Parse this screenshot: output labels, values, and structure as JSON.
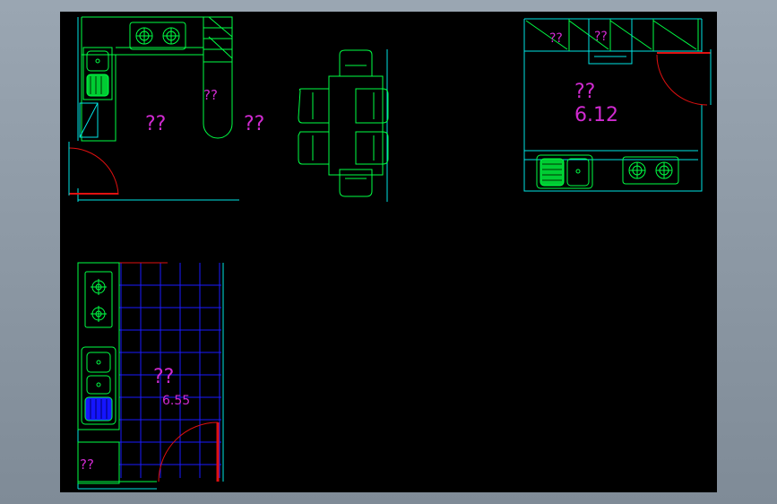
{
  "canvas": {
    "background": "#000000",
    "frame": "#8e9aa6"
  },
  "colors": {
    "wall": "#00e5e5",
    "fixture": "#00ff44",
    "door": "#e01010",
    "grid": "#1a1aff",
    "label": "#d02ad0",
    "sink_fill_green": "#00cc33",
    "sink_fill_blue": "#1515ff"
  },
  "labels": {
    "kitchen_a_left": "??",
    "kitchen_a_island": "??",
    "kitchen_a_right": "??",
    "kitchen_b_top1": "??",
    "kitchen_b_top2": "??",
    "kitchen_b_name": "??",
    "kitchen_b_area": "6.12",
    "kitchen_c_name": "??",
    "kitchen_c_area": "6.55",
    "kitchen_c_fridge": "??"
  },
  "icons": [
    "stove-icon",
    "sink-icon",
    "fridge-icon",
    "chair-icon",
    "door-swing-icon"
  ]
}
